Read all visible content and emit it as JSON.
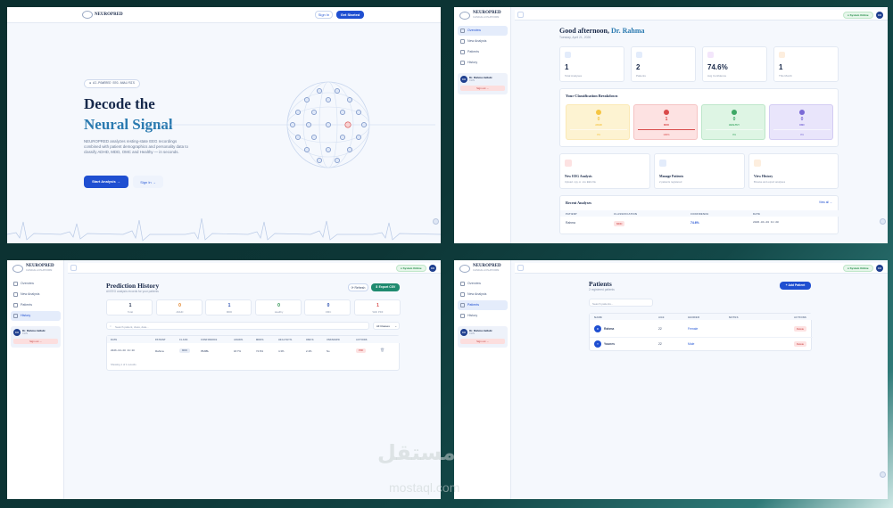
{
  "landing": {
    "brand": "NEUROPRED",
    "sign_in": "Sign In",
    "get_started": "Get Started",
    "tag": "● AI-POWERED EEG ANALYSIS",
    "title_line1": "Decode the",
    "title_line2": "Neural Signal",
    "description": "NEUROPRED analyzes resting-state EEG recordings combined with patient demographics and personality data to classify ADHD, MDD, OMC and Healthy — in seconds.",
    "start_analysis": "Start Analysis →",
    "sign_in_link": "Sign In →"
  },
  "app": {
    "brand": "NEUROPRED",
    "brand_sub": "CLINICAL AI PLATFORM",
    "status": "● System Online",
    "avatar": "DR",
    "nav": [
      "Overview",
      "New Analysis",
      "Patients",
      "History"
    ],
    "user_name": "Dr. Rahma Hellabi",
    "user_role": "CLIN",
    "sign_out": "Sign out →"
  },
  "overview": {
    "greeting": "Good afternoon,",
    "greeting_name": "Dr. Rahma",
    "date": "Tuesday, April 21, 2026",
    "stats": [
      {
        "value": "1",
        "label": "Total Analyses"
      },
      {
        "value": "2",
        "label": "Patients"
      },
      {
        "value": "74.6%",
        "label": "Avg Confidence"
      },
      {
        "value": "1",
        "label": "This Month"
      }
    ],
    "breakdown_title": "Your Classification Breakdown",
    "breakdown": [
      {
        "value": "0",
        "label": "ADHD",
        "pct": "0%",
        "color": "#f5c542",
        "bg": "#fdf3d2"
      },
      {
        "value": "1",
        "label": "MDD",
        "pct": "100%",
        "color": "#d94a4a",
        "bg": "#fde2e2"
      },
      {
        "value": "0",
        "label": "HEALTHY",
        "pct": "0%",
        "color": "#3ea865",
        "bg": "#def5e4"
      },
      {
        "value": "0",
        "label": "OMC",
        "pct": "0%",
        "color": "#7b6ad6",
        "bg": "#e9e5fb"
      }
    ],
    "actions": [
      {
        "title": "New EEG Analysis",
        "desc": "Upload .npy or .csv EEG file"
      },
      {
        "title": "Manage Patients",
        "desc": "2 patients registered"
      },
      {
        "title": "View History",
        "desc": "Browse and export analyses"
      }
    ],
    "recent_title": "Recent Analyses",
    "view_all": "View all →",
    "recent_headers": [
      "PATIENT",
      "CLASSIFICATION",
      "CONFIDENCE",
      "DATE"
    ],
    "recent_rows": [
      {
        "patient": "Rahma",
        "class": "MDD",
        "confidence": "74.6%",
        "date": "2026-04-20 11:20"
      }
    ]
  },
  "history": {
    "title": "Prediction History",
    "subtitle": "All EEG analysis records for your patients",
    "refresh": "⟳ Refresh",
    "export": "⬇ Export CSV",
    "stats": [
      {
        "value": "1",
        "label": "Total",
        "color": "#1a2a4a"
      },
      {
        "value": "0",
        "label": "ADHD",
        "color": "#e07b1a"
      },
      {
        "value": "1",
        "label": "MDD",
        "color": "#2a4fb0"
      },
      {
        "value": "0",
        "label": "Healthy",
        "color": "#1f8a45"
      },
      {
        "value": "0",
        "label": "OMC",
        "color": "#2a4fb0"
      },
      {
        "value": "1",
        "label": "With PDF",
        "color": "#d94a4a"
      }
    ],
    "search_placeholder": "Search patient, class, date...",
    "filter": "All Classes",
    "headers": [
      "DATE",
      "PATIENT",
      "CLASS",
      "CONFIDENCE",
      "ADHD%",
      "MDD%",
      "HEALTHY%",
      "OMC%",
      "UNKNOWN",
      "ACTIONS"
    ],
    "rows": [
      {
        "date": "2026-04-20 11:20",
        "patient": "Rahma",
        "class": "MDD",
        "confidence": "74.6%",
        "adhd": "18.7%",
        "mdd": "74.6%",
        "healthy": "4.3%",
        "omc": "2.4%",
        "unknown": "No",
        "pdf": "PDF"
      }
    ],
    "footer": "Showing 1 of 1 records"
  },
  "patients": {
    "title": "Patients",
    "subtitle": "2 registered patients",
    "add": "+ Add Patient",
    "search_placeholder": "Search patients...",
    "headers": [
      "NAME",
      "AGE",
      "GENDER",
      "NOTES",
      "ACTIONS"
    ],
    "rows": [
      {
        "initial": "R",
        "name": "Rahma",
        "age": "22",
        "gender": "Female",
        "notes": "",
        "action": "Delete"
      },
      {
        "initial": "Y",
        "name": "Younes",
        "age": "22",
        "gender": "Male",
        "notes": "",
        "action": "Delete"
      }
    ]
  },
  "watermark": {
    "arabic": "مستقل",
    "latin": "mostaql.com"
  }
}
